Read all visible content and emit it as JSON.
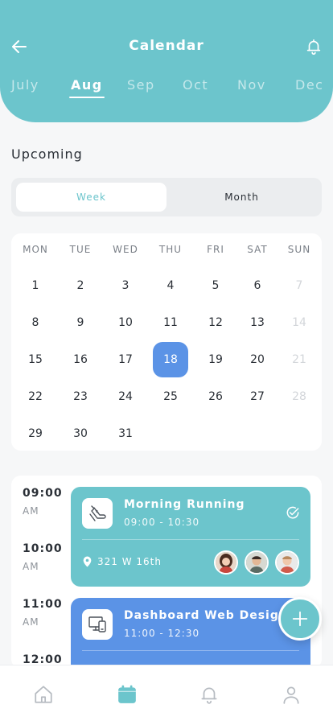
{
  "header": {
    "title": "Calendar",
    "months": [
      "July",
      "Aug",
      "Sep",
      "Oct",
      "Nov",
      "Dec"
    ],
    "active_month": "Aug",
    "back_icon": "arrow-left-icon",
    "bell_icon": "bell-icon"
  },
  "section_title": "Upcoming",
  "toggle": {
    "week": "Week",
    "month": "Month",
    "selected": "Week"
  },
  "calendar": {
    "weekdays": [
      "MON",
      "TUE",
      "WED",
      "THU",
      "FRI",
      "SAT",
      "SUN"
    ],
    "weeks": [
      [
        "1",
        "2",
        "3",
        "4",
        "5",
        "6",
        "7"
      ],
      [
        "8",
        "9",
        "10",
        "11",
        "12",
        "13",
        "14"
      ],
      [
        "15",
        "16",
        "17",
        "18",
        "19",
        "20",
        "21"
      ],
      [
        "22",
        "23",
        "24",
        "25",
        "26",
        "27",
        "28"
      ],
      [
        "29",
        "30",
        "31",
        "",
        "",
        "",
        ""
      ]
    ],
    "selected_day": "18"
  },
  "agenda": {
    "times": [
      {
        "time": "09:00",
        "period": "AM"
      },
      {
        "time": "10:00",
        "period": "AM"
      },
      {
        "time": "11:00",
        "period": "AM"
      },
      {
        "time": "12:00",
        "period": ""
      }
    ],
    "events": [
      {
        "title": "Morning Running",
        "time": "09:00 - 10:30",
        "location": "321 W 16th",
        "color": "#6cc5cc",
        "icon": "running-shoe-icon"
      },
      {
        "title": "Dashboard Web Design",
        "time": "11:00 - 12:30",
        "color": "#5b93e6",
        "icon": "devices-icon"
      }
    ]
  },
  "colors": {
    "accent": "#6cc5cc",
    "selected_day": "#5b93e6",
    "event_blue": "#5b93e6"
  },
  "nav": [
    "home-icon",
    "calendar-icon",
    "bell-icon",
    "profile-icon"
  ],
  "nav_active": "calendar-icon"
}
